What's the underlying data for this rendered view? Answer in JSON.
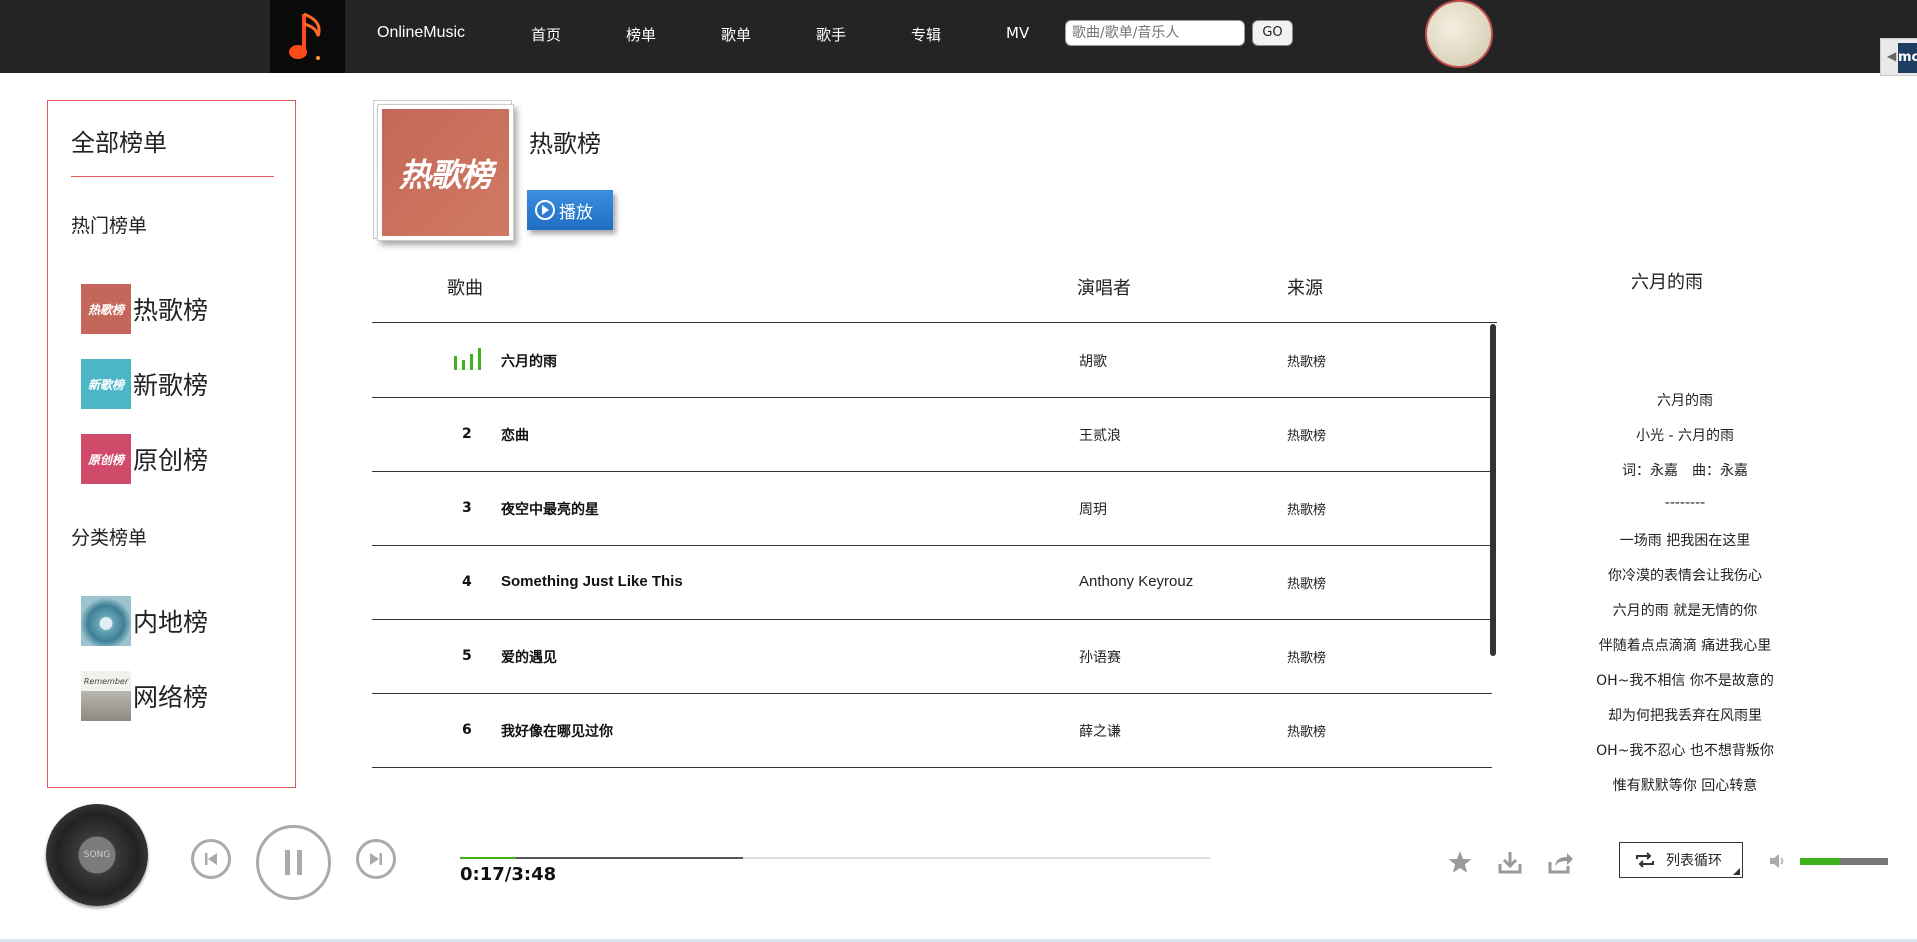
{
  "nav": {
    "brand": "OnlineMusic",
    "items": [
      "首页",
      "榜单",
      "歌单",
      "歌手",
      "专辑",
      "MV"
    ],
    "search_placeholder": "歌曲/歌单/音乐人",
    "go_label": "GO",
    "side_tab_label": "mo"
  },
  "sidebar": {
    "title": "全部榜单",
    "hot_section": "热门榜单",
    "hot_items": [
      {
        "label": "热歌榜",
        "thumb": "热歌榜",
        "color": "#c4675a"
      },
      {
        "label": "新歌榜",
        "thumb": "新歌榜",
        "color": "#4db6c6"
      },
      {
        "label": "原创榜",
        "thumb": "原创榜",
        "color": "#d04a6a"
      }
    ],
    "category_section": "分类榜单",
    "category_items": [
      {
        "label": "内地榜"
      },
      {
        "label": "网络榜",
        "thumb": "Remember"
      }
    ]
  },
  "playlist": {
    "cover_text": "热歌榜",
    "title": "热歌榜",
    "play_label": "播放"
  },
  "table": {
    "headers": {
      "song": "歌曲",
      "artist": "演唱者",
      "source": "来源"
    },
    "rows": [
      {
        "num": "",
        "song": "六月的雨",
        "artist": "胡歌",
        "source": "热歌榜",
        "playing": true
      },
      {
        "num": "2",
        "song": "恋曲",
        "artist": "王贰浪",
        "source": "热歌榜"
      },
      {
        "num": "3",
        "song": "夜空中最亮的星",
        "artist": "周玥",
        "source": "热歌榜"
      },
      {
        "num": "4",
        "song": "Something Just Like This",
        "artist": "Anthony Keyrouz",
        "source": "热歌榜"
      },
      {
        "num": "5",
        "song": "爱的遇见",
        "artist": "孙语赛",
        "source": "热歌榜"
      },
      {
        "num": "6",
        "song": "我好像在哪见过你",
        "artist": "薛之谦",
        "source": "热歌榜"
      }
    ]
  },
  "lyrics": {
    "title": "六月的雨",
    "lines": [
      "六月的雨",
      "小光 - 六月的雨",
      "词：永嘉　曲：永嘉",
      "--------",
      "一场雨 把我困在这里",
      "你冷漠的表情会让我伤心",
      "六月的雨 就是无情的你",
      "伴随着点点滴滴 痛进我心里",
      "OH~我不相信 你不是故意的",
      "却为何把我丢弃在风雨里",
      "OH~我不忍心 也不想背叛你",
      "惟有默默等你 回心转意"
    ]
  },
  "player": {
    "disc_label": "SONG",
    "time": "0:17/3:48",
    "progress": 0.074,
    "buffered": 0.377,
    "loop_label": "列表循环",
    "volume": 0.45,
    "accent": "#3fb31b"
  }
}
